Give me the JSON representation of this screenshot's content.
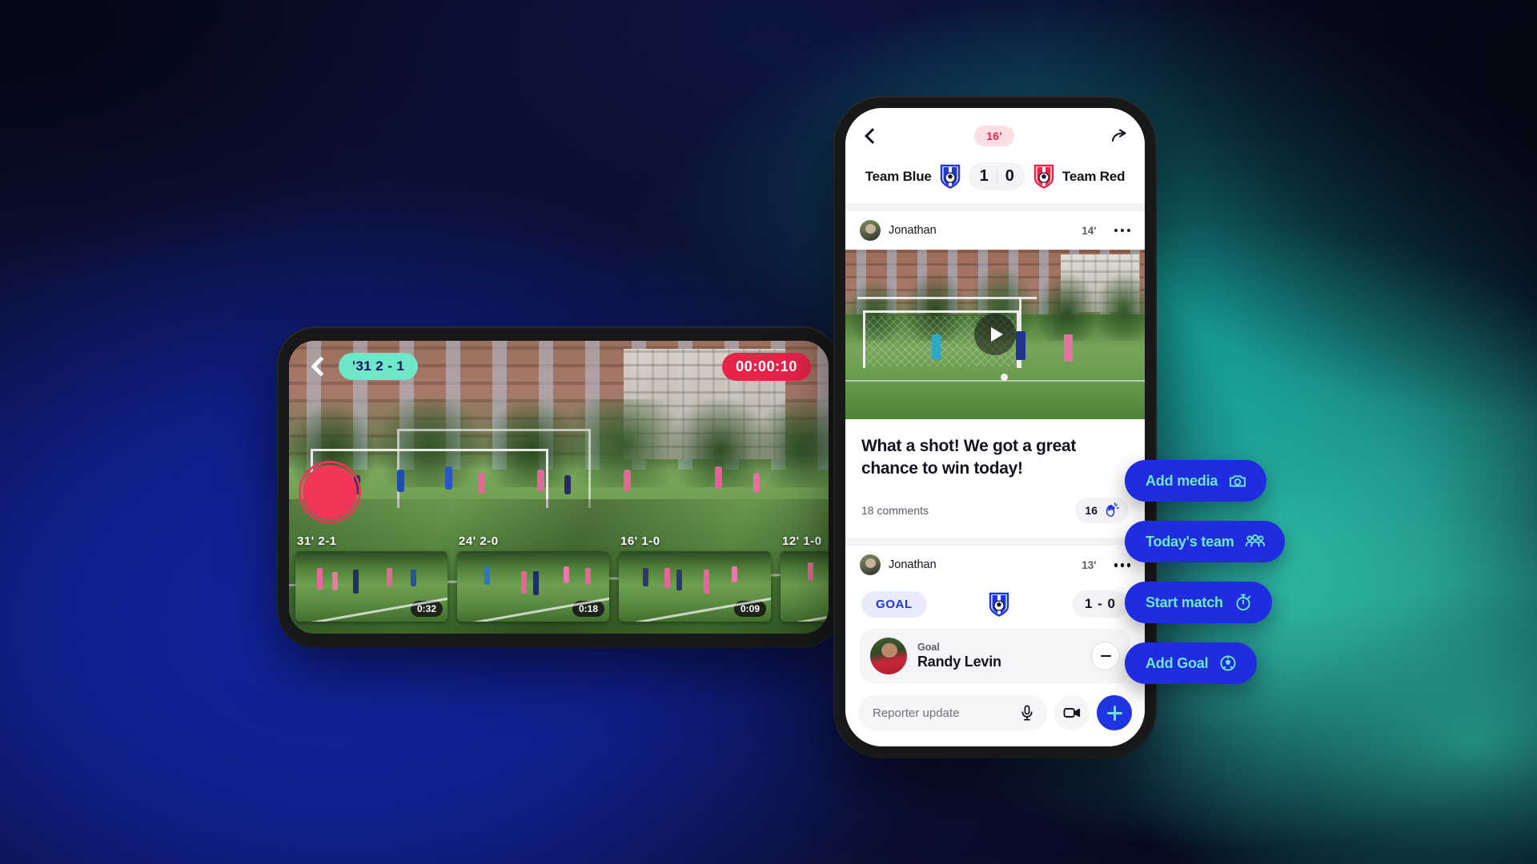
{
  "colors": {
    "brand_blue": "#1f2ce0",
    "mint": "#6ee7c8",
    "red": "#e8234a",
    "pink_badge_bg": "#fbdfe3",
    "goal_tag_bg": "#e9ebfd",
    "goal_tag_text": "#1f35e0",
    "bg_deep_blue": "#12239e",
    "bg_teal": "#3fd3b6",
    "text_dark": "#14141e",
    "text_muted": "#5b5b66"
  },
  "landscape_phone": {
    "back_icon": "chevron-left-icon",
    "clip_badge": "'31  2 - 1",
    "timer": "00:00:10",
    "record_button_label": "record",
    "thumbnails": [
      {
        "label": "31' 2-1",
        "duration": "0:32"
      },
      {
        "label": "24' 2-0",
        "duration": "0:18"
      },
      {
        "label": "16' 1-0",
        "duration": "0:09"
      },
      {
        "label": "12' 1-0",
        "duration": ""
      }
    ]
  },
  "portrait_phone": {
    "header": {
      "back_icon": "chevron-left-icon",
      "minute_badge": "16'",
      "share_icon": "share-arrow-icon",
      "home_team": "Team Blue",
      "away_team": "Team Red",
      "home_score": "1",
      "away_score": "0",
      "home_crest_icon": "blue-club-crest-icon",
      "away_crest_icon": "red-club-crest-icon"
    },
    "posts": [
      {
        "author": "Jonathan",
        "time": "14'",
        "menu_icon": "more-options-icon",
        "media_type": "video",
        "play_icon": "play-icon",
        "title": "What a shot! We got a great chance to win today!",
        "comments": "18 comments",
        "clap_count": "16",
        "clap_icon": "clap-icon"
      },
      {
        "author": "Jonathan",
        "time": "13'",
        "menu_icon": "more-options-icon",
        "event_tag": "GOAL",
        "event_crest_icon": "blue-club-crest-icon",
        "event_score": "1 - 0",
        "scorer_role": "Goal",
        "scorer_name": "Randy Levin",
        "remove_icon": "minus-icon"
      }
    ],
    "composer": {
      "placeholder": "Reporter update",
      "mic_icon": "microphone-icon",
      "video_icon": "video-camera-icon",
      "add_icon": "plus-icon"
    }
  },
  "fabs": [
    {
      "label": "Add media",
      "icon": "camera-icon"
    },
    {
      "label": "Today's team",
      "icon": "people-group-icon"
    },
    {
      "label": "Start match",
      "icon": "stopwatch-icon"
    },
    {
      "label": "Add Goal",
      "icon": "soccer-ball-icon"
    }
  ]
}
